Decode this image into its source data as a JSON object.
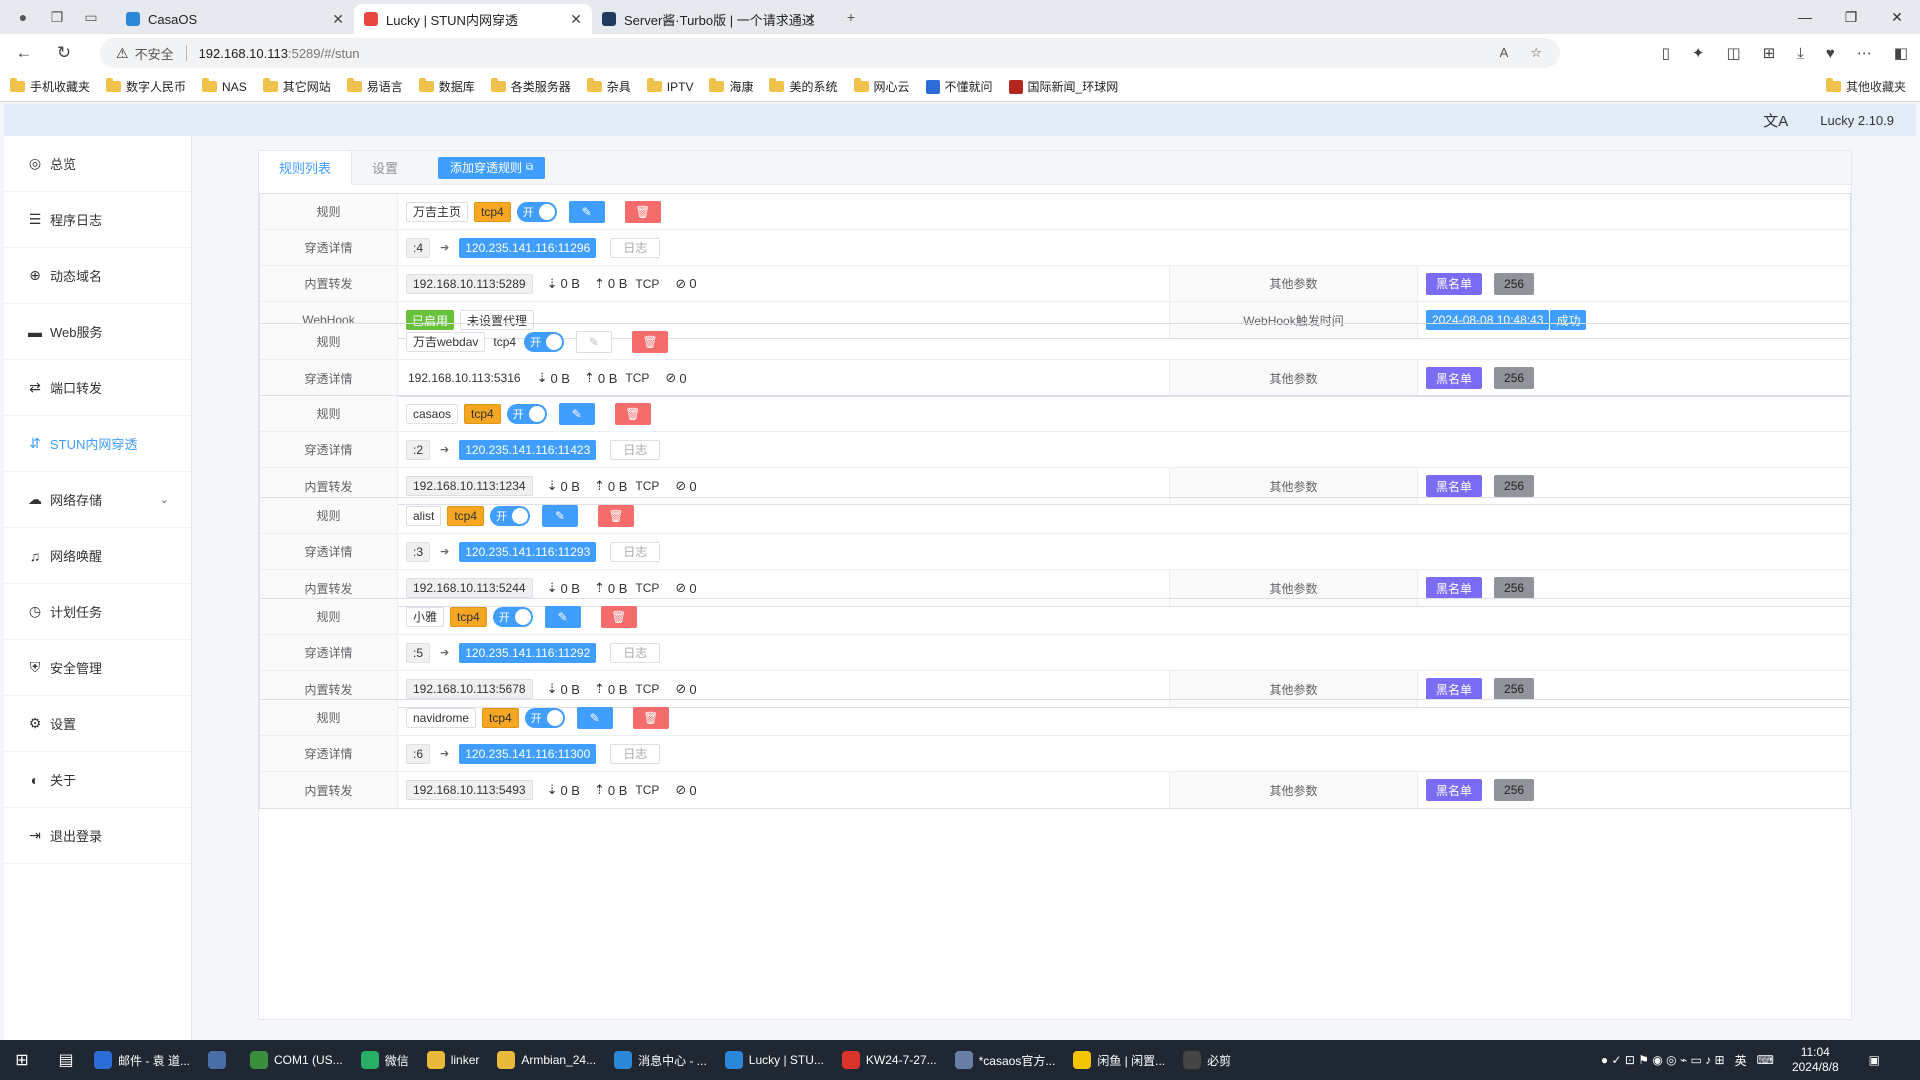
{
  "browser": {
    "tabs": [
      {
        "title": "CasaOS",
        "color": "#2b88d8",
        "active": false
      },
      {
        "title": "Lucky | STUN内网穿透",
        "color": "#e9463f",
        "active": true
      },
      {
        "title": "Server酱·Turbo版 | 一个请求通过",
        "color": "#1e3a5f",
        "active": false
      }
    ],
    "address_warning": "不安全",
    "address_host": "192.168.10.113",
    "address_path": ":5289/#/stun"
  },
  "bookmarks": [
    "手机收藏夹",
    "数字人民币",
    "NAS",
    "其它网站",
    "易语言",
    "数据库",
    "各类服务器",
    "杂具",
    "IPTV",
    "海康",
    "美的系统",
    "网心云",
    "不懂就问",
    "国际新闻_环球网"
  ],
  "bookmarks_right": "其他收藏夹",
  "app": {
    "version": "Lucky 2.10.9",
    "sidebar": [
      {
        "label": "总览",
        "icon": "dashboard-icon",
        "glyph": "◎"
      },
      {
        "label": "程序日志",
        "icon": "log-icon",
        "glyph": "☰"
      },
      {
        "label": "动态域名",
        "icon": "ddns-icon",
        "glyph": "⊕"
      },
      {
        "label": "Web服务",
        "icon": "web-icon",
        "glyph": "▬"
      },
      {
        "label": "端口转发",
        "icon": "port-forward-icon",
        "glyph": "⇄"
      },
      {
        "label": "STUN内网穿透",
        "icon": "stun-icon",
        "glyph": "⇵",
        "active": true
      },
      {
        "label": "网络存储",
        "icon": "cloud-icon",
        "glyph": "☁",
        "expand": true
      },
      {
        "label": "网络唤醒",
        "icon": "bell-icon",
        "glyph": "♫"
      },
      {
        "label": "计划任务",
        "icon": "clock-icon",
        "glyph": "◷"
      },
      {
        "label": "安全管理",
        "icon": "shield-icon",
        "glyph": "⛨"
      },
      {
        "label": "设置",
        "icon": "gear-icon",
        "glyph": "⚙"
      },
      {
        "label": "关于",
        "icon": "about-icon",
        "glyph": "◐"
      },
      {
        "label": "退出登录",
        "icon": "logout-icon",
        "glyph": "⇥"
      }
    ],
    "tabs": {
      "list": "规则列表",
      "settings": "设置",
      "add": "添加穿透规则"
    },
    "labels": {
      "rule": "规则",
      "detail": "穿透详情",
      "forward": "内置转发",
      "webhook": "WebHook",
      "other": "其他参数",
      "webhook_time": "WebHook触发时间",
      "on": "开",
      "log": "日志",
      "blacklist": "黑名单",
      "tcp": "TCP",
      "zero": "0 B",
      "conn_zero": "0"
    },
    "rules": [
      {
        "name": "万吉主页",
        "proto": "tcp4",
        "proto_tag": true,
        "port": ":4",
        "public": "120.235.141.116:11296",
        "local": "192.168.10.113:5289",
        "num": "256",
        "webhook": {
          "enabled": "已启用",
          "proxy": "未设置代理",
          "time": "2024-08-08 10:48:43",
          "status": "成功"
        }
      },
      {
        "name": "万吉webdav",
        "proto": "tcp4",
        "proto_tag": false,
        "edit_disabled": true,
        "detail_inline": true,
        "local": "192.168.10.113:5316",
        "num": "256"
      },
      {
        "name": "casaos",
        "proto": "tcp4",
        "proto_tag": true,
        "port": ":2",
        "public": "120.235.141.116:11423",
        "local": "192.168.10.113:1234",
        "num": "256"
      },
      {
        "name": "alist",
        "proto": "tcp4",
        "proto_tag": true,
        "port": ":3",
        "public": "120.235.141.116:11293",
        "local": "192.168.10.113:5244",
        "num": "256"
      },
      {
        "name": "小雅",
        "proto": "tcp4",
        "proto_tag": true,
        "port": ":5",
        "public": "120.235.141.116:11292",
        "local": "192.168.10.113:5678",
        "num": "256"
      },
      {
        "name": "navidrome",
        "proto": "tcp4",
        "proto_tag": true,
        "port": ":6",
        "public": "120.235.141.116:11300",
        "local": "192.168.10.113:5493",
        "num": "256"
      }
    ]
  },
  "taskbar": {
    "items": [
      {
        "label": "邮件 - 袁 道...",
        "color": "#2b6cd8"
      },
      {
        "label": "",
        "color": "#4a6fa5"
      },
      {
        "label": "COM1  (US...",
        "color": "#3a8f3a"
      },
      {
        "label": "微信",
        "color": "#2aae67"
      },
      {
        "label": "linker",
        "color": "#e8b93a"
      },
      {
        "label": "Armbian_24...",
        "color": "#e8b93a"
      },
      {
        "label": "消息中心 - ...",
        "color": "#2b88d8"
      },
      {
        "label": "Lucky | STU...",
        "color": "#2b88d8"
      },
      {
        "label": "KW24-7-27...",
        "color": "#d9342b"
      },
      {
        "label": "*casaos官方...",
        "color": "#6a7fa8"
      },
      {
        "label": "闲鱼 | 闲置...",
        "color": "#f5c400"
      },
      {
        "label": "必剪",
        "color": "#444"
      }
    ],
    "ime": "英",
    "time": "11:04",
    "date": "2024/8/8"
  }
}
